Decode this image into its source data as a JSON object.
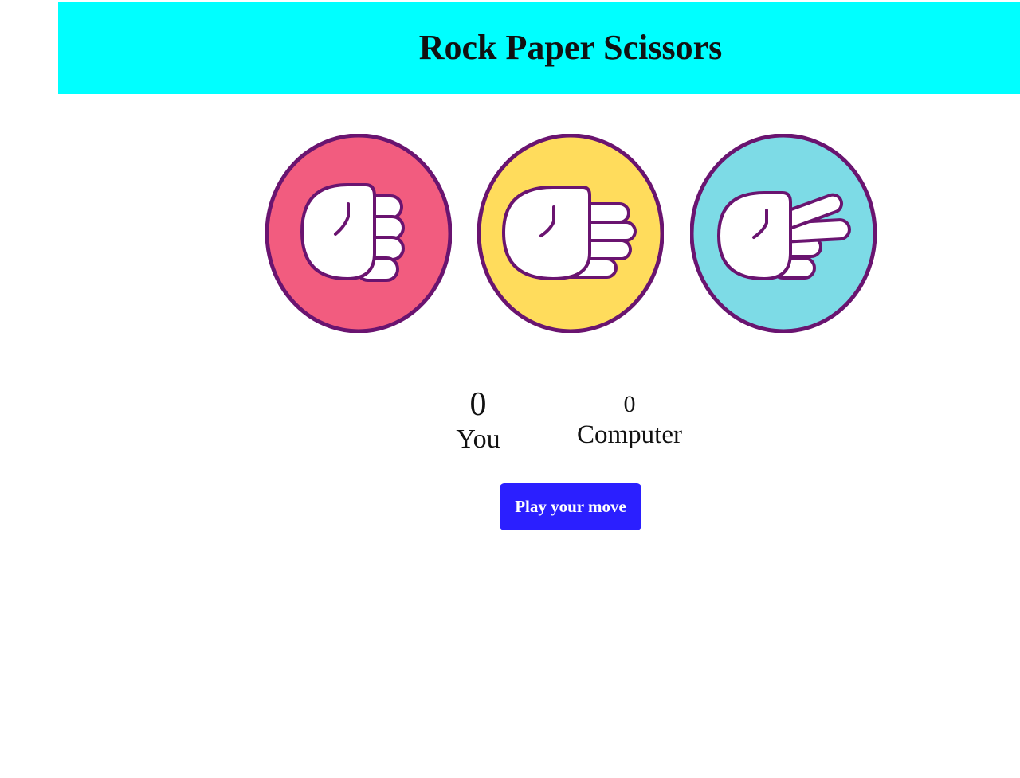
{
  "header": {
    "title": "Rock Paper Scissors",
    "background_color": "#00ffff"
  },
  "choices": [
    {
      "name": "rock",
      "icon": "fist-icon",
      "color": "#f25c7f"
    },
    {
      "name": "paper",
      "icon": "open-hand-icon",
      "color": "#ffdc5c"
    },
    {
      "name": "scissors",
      "icon": "two-fingers-icon",
      "color": "#7ddbe6"
    }
  ],
  "scoreboard": {
    "you": {
      "score": "0",
      "label": "You"
    },
    "computer": {
      "score": "0",
      "label": "Computer"
    }
  },
  "actions": {
    "play_label": "Play your move",
    "play_color": "#2b1fff"
  },
  "colors": {
    "outline": "#6a1470"
  }
}
